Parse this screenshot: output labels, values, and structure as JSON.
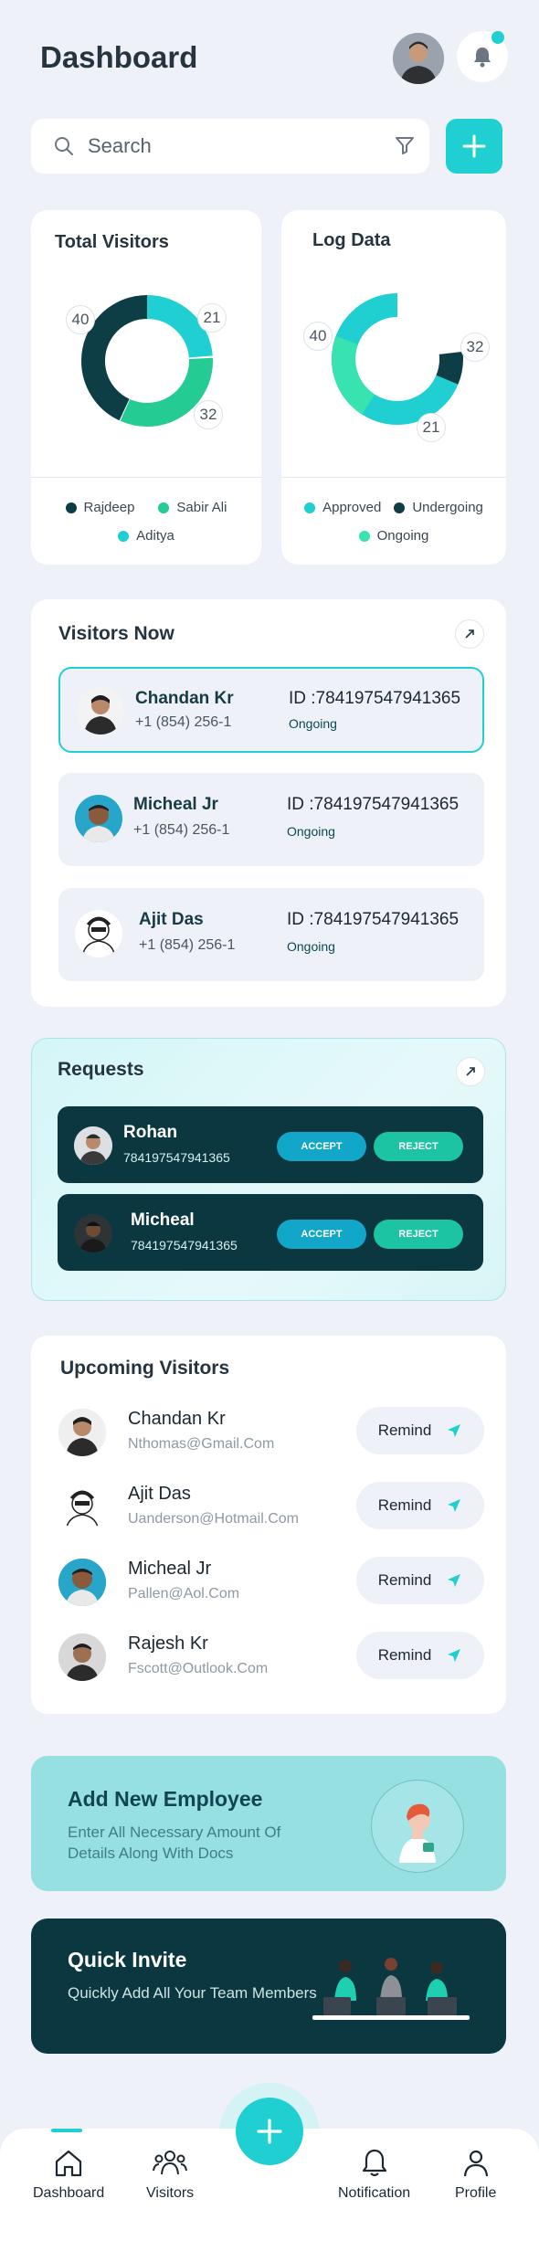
{
  "header": {
    "title": "Dashboard"
  },
  "search": {
    "placeholder": "Search"
  },
  "total_visitors": {
    "title": "Total Visitors",
    "labels": [
      "40",
      "21",
      "32"
    ],
    "legend": [
      "Rajdeep",
      "Sabir Ali",
      "Aditya"
    ],
    "colors": [
      "#0d3e45",
      "#24cb92",
      "#1fcfd2"
    ]
  },
  "log_data": {
    "title": "Log Data",
    "labels": [
      "40",
      "32",
      "21"
    ],
    "legend": [
      "Approved",
      "Undergoing",
      "Ongoing"
    ],
    "colors": [
      "#1fcfd2",
      "#0d3e45",
      "#38e2b1"
    ]
  },
  "visitors_now": {
    "title": "Visitors Now",
    "items": [
      {
        "name": "Chandan Kr",
        "phone": "+1 (854) 256-1",
        "id": "ID :784197547941365",
        "status": "Ongoing"
      },
      {
        "name": "Micheal Jr",
        "phone": "+1 (854) 256-1",
        "id": "ID :784197547941365",
        "status": "Ongoing"
      },
      {
        "name": "Ajit Das",
        "phone": "+1 (854) 256-1",
        "id": "ID :784197547941365",
        "status": "Ongoing"
      }
    ]
  },
  "requests": {
    "title": "Requests",
    "accept_label": "ACCEPT",
    "reject_label": "REJECT",
    "items": [
      {
        "name": "Rohan",
        "id": "784197547941365"
      },
      {
        "name": "Micheal",
        "id": "784197547941365"
      }
    ]
  },
  "upcoming": {
    "title": "Upcoming Visitors",
    "remind_label": "Remind",
    "items": [
      {
        "name": "Chandan Kr",
        "email": "Nthomas@Gmail.Com"
      },
      {
        "name": "Ajit Das",
        "email": "Uanderson@Hotmail.Com"
      },
      {
        "name": "Micheal Jr",
        "email": "Pallen@Aol.Com"
      },
      {
        "name": "Rajesh Kr",
        "email": "Fscott@Outlook.Com"
      }
    ]
  },
  "add_employee": {
    "title": "Add New Employee",
    "description": "Enter All Necessary Amount Of Details Along With Docs"
  },
  "quick_invite": {
    "title": "Quick Invite",
    "description": "Quickly Add All Your Team Members"
  },
  "nav": {
    "dashboard": "Dashboard",
    "visitors": "Visitors",
    "notification": "Notification",
    "profile": "Profile"
  },
  "colors": {
    "accent": "#1fcfd2",
    "dark": "#0b3840",
    "background": "#eef1f8"
  }
}
